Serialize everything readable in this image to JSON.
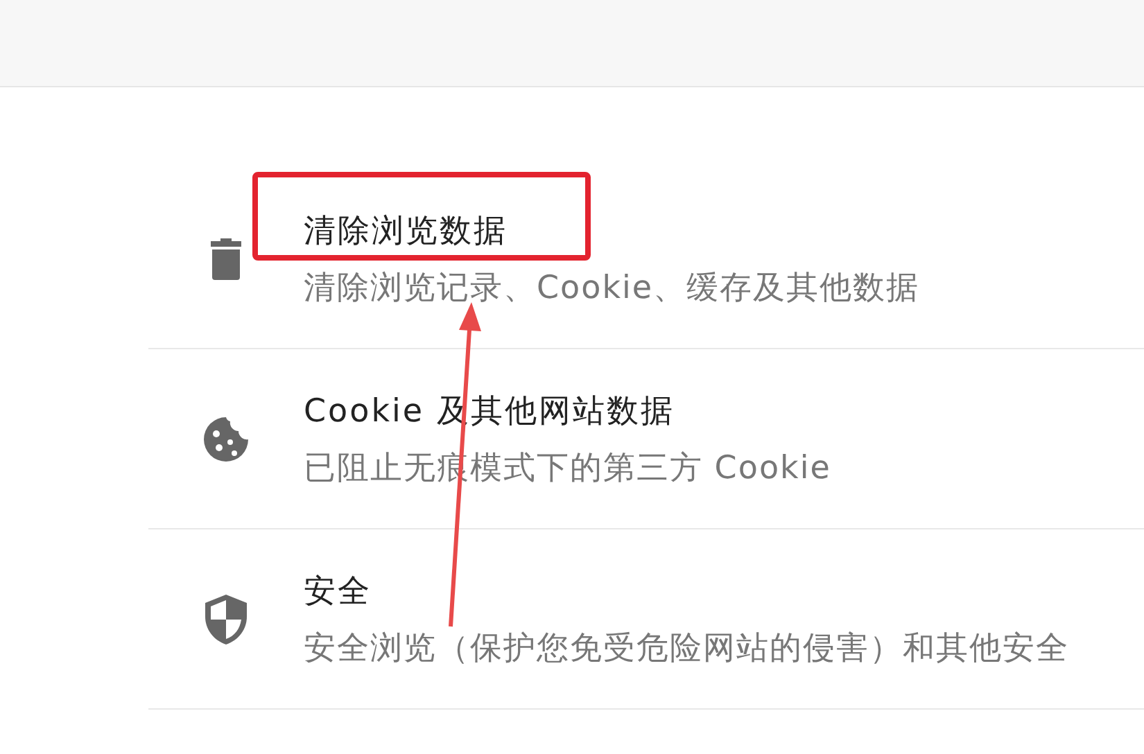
{
  "items": [
    {
      "title": "清除浏览数据",
      "subtitle": "清除浏览记录、Cookie、缓存及其他数据"
    },
    {
      "title": "Cookie 及其他网站数据",
      "subtitle": "已阻止无痕模式下的第三方 Cookie"
    },
    {
      "title": "安全",
      "subtitle": "安全浏览（保护您免受危险网站的侵害）和其他安全"
    }
  ]
}
